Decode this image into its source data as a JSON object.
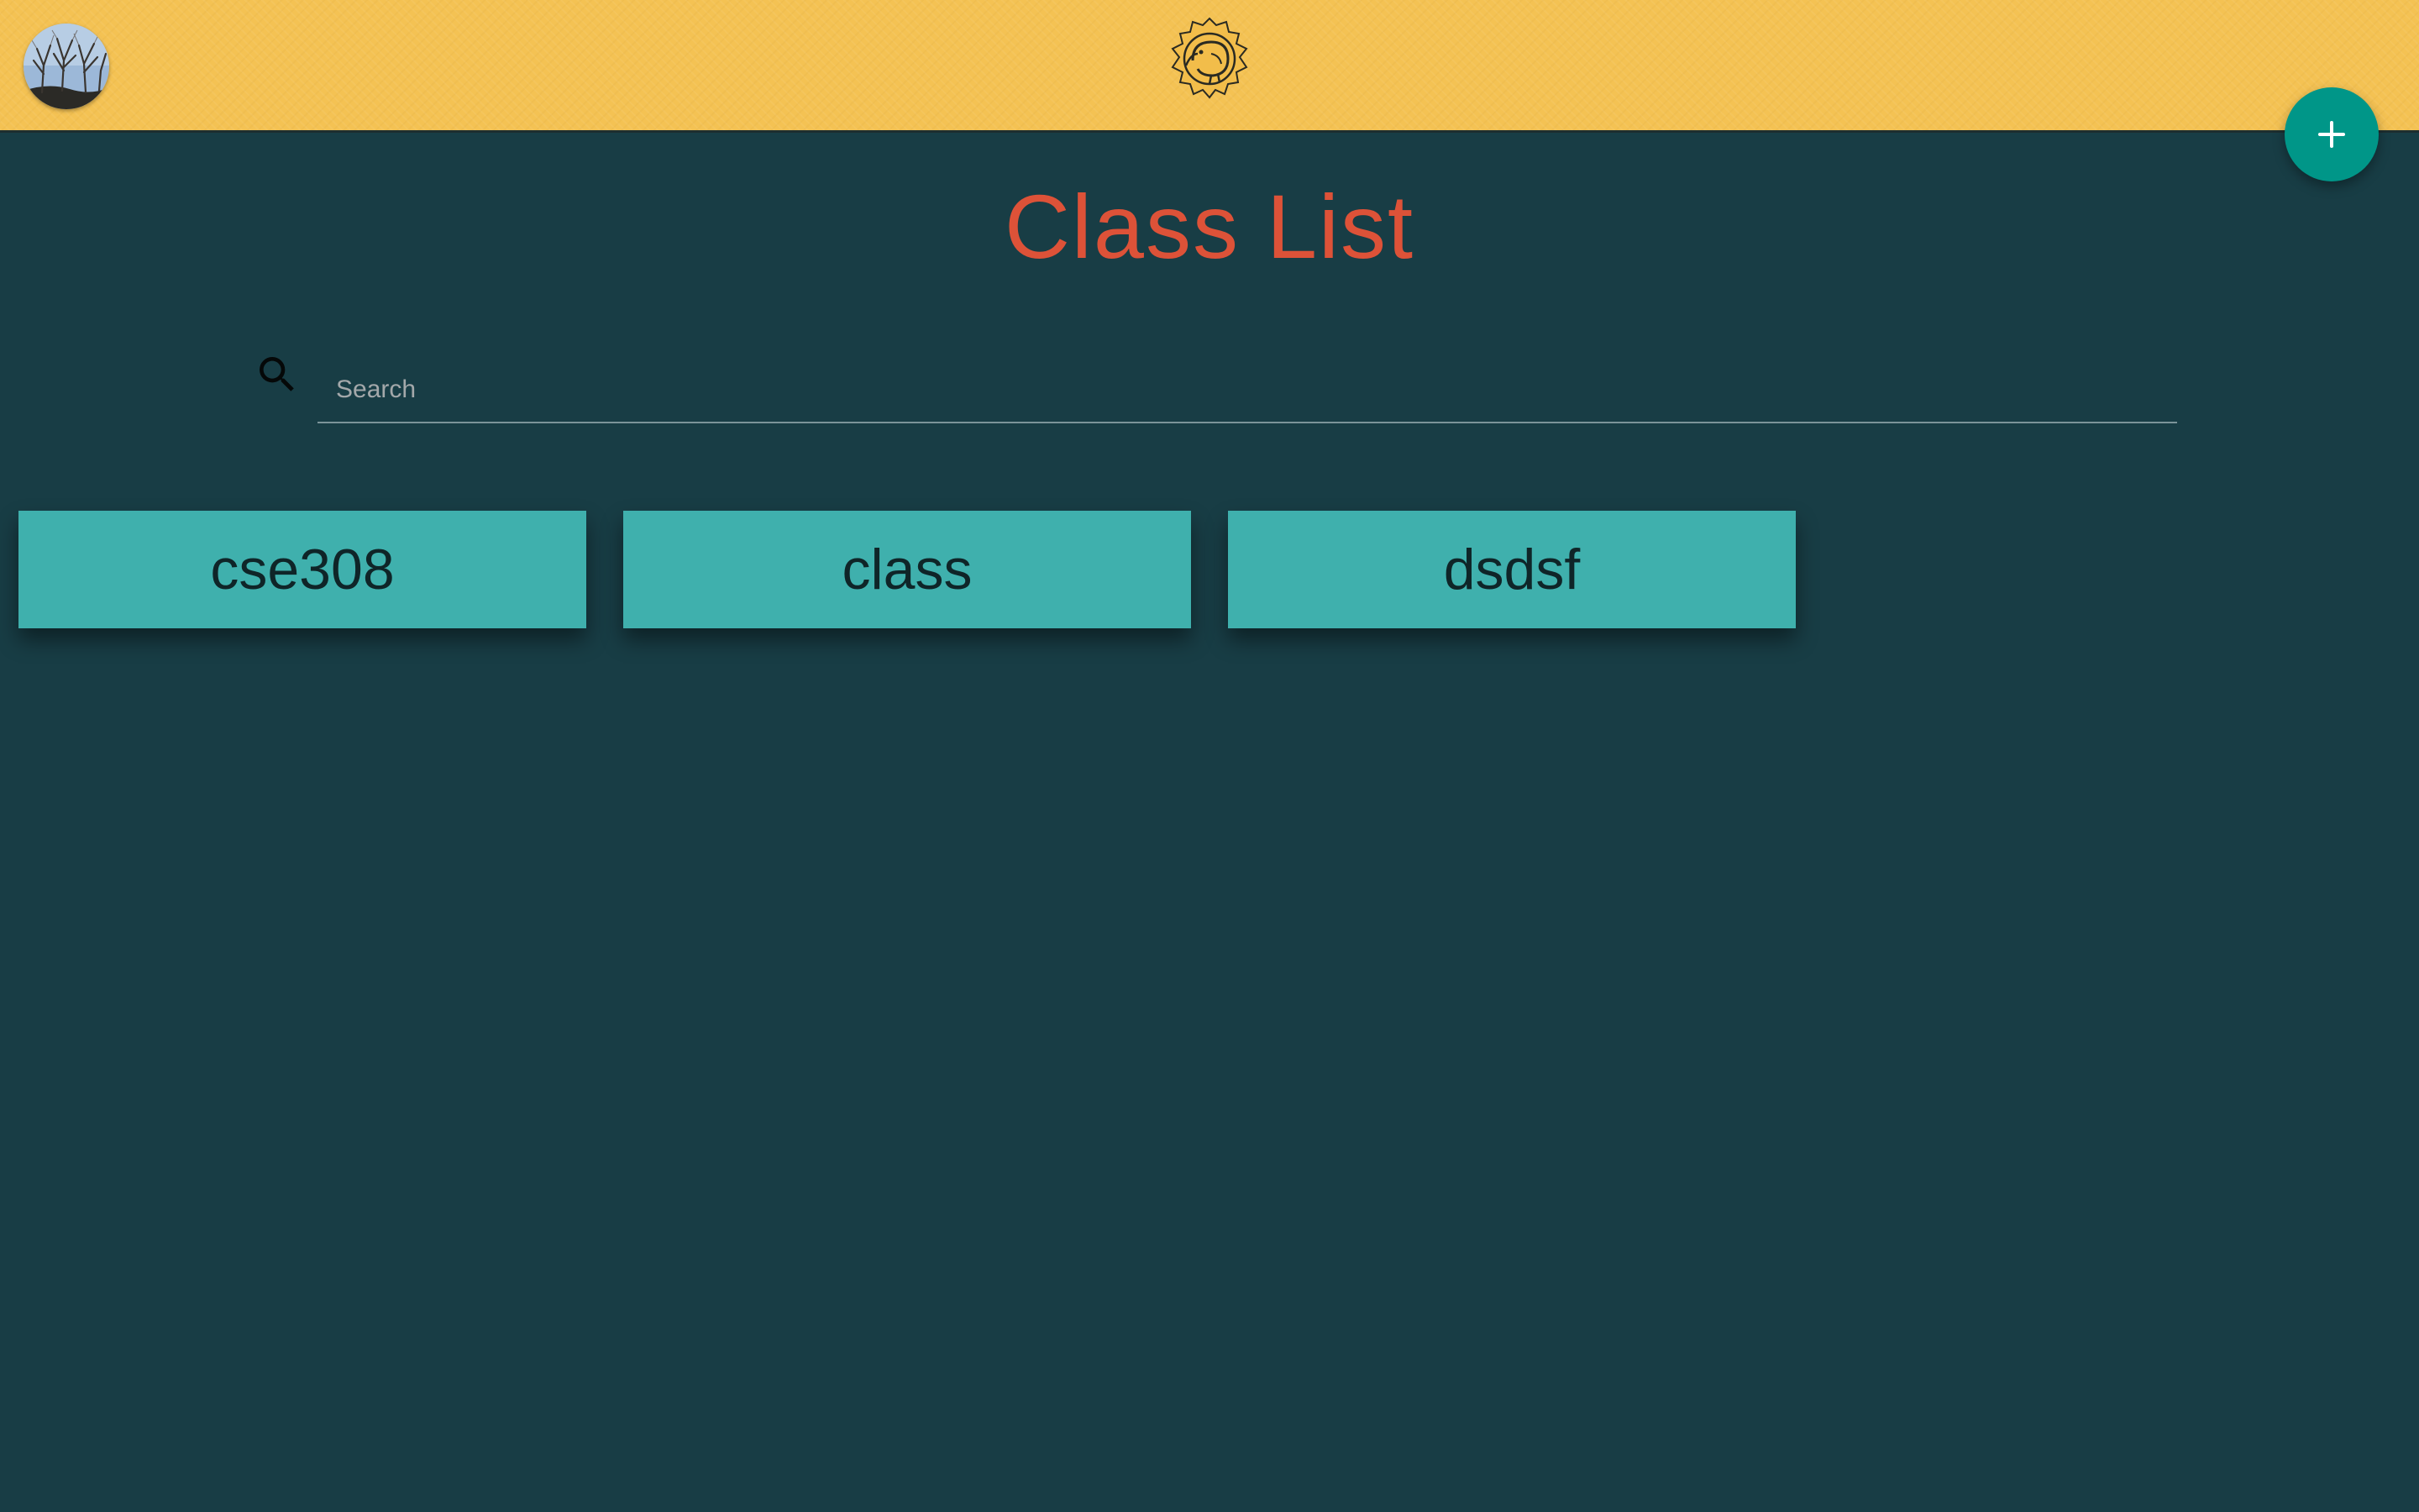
{
  "header": {
    "avatar_icon": "profile-photo-trees",
    "logo_icon": "kiwi-bird-badge-logo",
    "add_button_label": "+"
  },
  "main": {
    "title": "Class List",
    "search": {
      "placeholder": "Search",
      "value": "",
      "icon": "search-icon"
    },
    "classes": [
      {
        "name": "cse308"
      },
      {
        "name": "class"
      },
      {
        "name": "dsdsf"
      }
    ]
  },
  "colors": {
    "header_bg": "#f4c253",
    "page_bg": "#183d45",
    "title": "#dd5238",
    "card_bg": "#3fb0ad",
    "fab_bg": "#009688"
  }
}
